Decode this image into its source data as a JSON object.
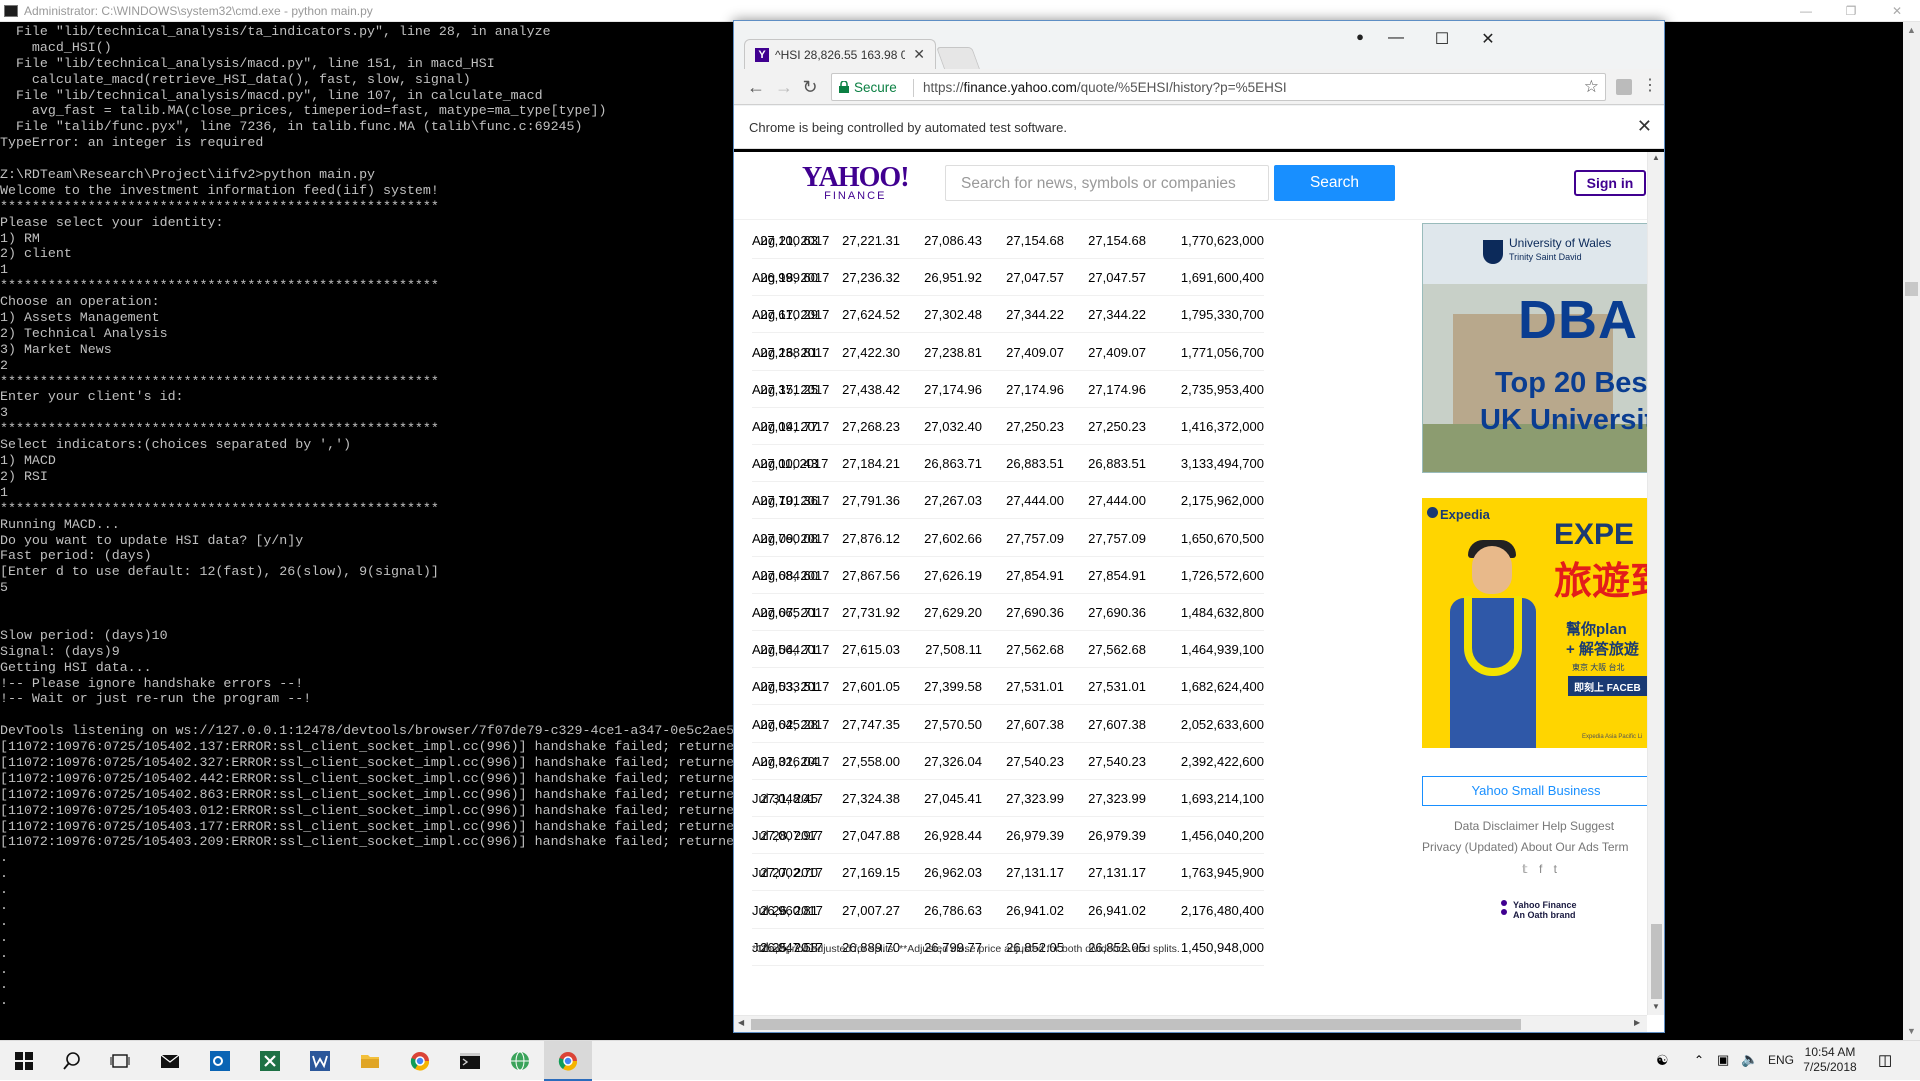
{
  "cmd": {
    "title": "Administrator: C:\\WINDOWS\\system32\\cmd.exe - python  main.py",
    "lines": [
      "  File \"lib/technical_analysis/ta_indicators.py\", line 28, in analyze",
      "    macd_HSI()",
      "  File \"lib/technical_analysis/macd.py\", line 151, in macd_HSI",
      "    calculate_macd(retrieve_HSI_data(), fast, slow, signal)",
      "  File \"lib/technical_analysis/macd.py\", line 107, in calculate_macd",
      "    avg_fast = talib.MA(close_prices, timeperiod=fast, matype=ma_type[type])",
      "  File \"talib/func.pyx\", line 7236, in talib.func.MA (talib\\func.c:69245)",
      "TypeError: an integer is required",
      "",
      "Z:\\RDTeam\\Research\\Project\\iifv2>python main.py",
      "Welcome to the investment information feed(iif) system!",
      "*******************************************************",
      "Please select your identity:",
      "1) RM",
      "2) client",
      "1",
      "*******************************************************",
      "Choose an operation:",
      "1) Assets Management",
      "2) Technical Analysis",
      "3) Market News",
      "2",
      "*******************************************************",
      "Enter your client's id:",
      "3",
      "*******************************************************",
      "Select indicators:(choices separated by ',')",
      "1) MACD",
      "2) RSI",
      "1",
      "*******************************************************",
      "Running MACD...",
      "Do you want to update HSI data? [y/n]y",
      "Fast period: (days)",
      "[Enter d to use default: 12(fast), 26(slow), 9(signal)]",
      "5",
      "",
      "",
      "Slow period: (days)10",
      "Signal: (days)9",
      "Getting HSI data...",
      "!-- Please ignore handshake errors --!",
      "!-- Wait or just re-run the program --!",
      "",
      "DevTools listening on ws://127.0.0.1:12478/devtools/browser/7f07de79-c329-4ce1-a347-0e5c2ae5",
      "[11072:10976:0725/105402.137:ERROR:ssl_client_socket_impl.cc(996)] handshake failed; returne",
      "[11072:10976:0725/105402.327:ERROR:ssl_client_socket_impl.cc(996)] handshake failed; returne",
      "[11072:10976:0725/105402.442:ERROR:ssl_client_socket_impl.cc(996)] handshake failed; returne",
      "[11072:10976:0725/105402.863:ERROR:ssl_client_socket_impl.cc(996)] handshake failed; returne",
      "[11072:10976:0725/105403.012:ERROR:ssl_client_socket_impl.cc(996)] handshake failed; returne",
      "[11072:10976:0725/105403.177:ERROR:ssl_client_socket_impl.cc(996)] handshake failed; returne",
      "[11072:10976:0725/105403.209:ERROR:ssl_client_socket_impl.cc(996)] handshake failed; returne",
      ".",
      ".",
      ".",
      ".",
      ".",
      ".",
      ".",
      ".",
      ".",
      "."
    ]
  },
  "chrome": {
    "tab_title": "^HSI 28,826.55 163.98 0.",
    "secure_label": "Secure",
    "url_prefix": "https://",
    "url_host": "finance.yahoo.com",
    "url_path": "/quote/%5EHSI/history?p=%5EHSI",
    "infobar_message": "Chrome is being controlled by automated test software."
  },
  "yahoo": {
    "logo_main": "YAHOO!",
    "logo_sub": "FINANCE",
    "search_placeholder": "Search for news, symbols or companies",
    "search_button": "Search",
    "sign_in": "Sign in"
  },
  "history_rows": [
    [
      "Aug 21, 2017",
      "27,100.63",
      "27,221.31",
      "27,086.43",
      "27,154.68",
      "27,154.68",
      "1,770,623,000"
    ],
    [
      "Aug 18, 2017",
      "26,999.60",
      "27,236.32",
      "26,951.92",
      "27,047.57",
      "27,047.57",
      "1,691,600,400"
    ],
    [
      "Aug 17, 2017",
      "27,610.29",
      "27,624.52",
      "27,302.48",
      "27,344.22",
      "27,344.22",
      "1,795,330,700"
    ],
    [
      "Aug 16, 2017",
      "27,238.81",
      "27,422.30",
      "27,238.81",
      "27,409.07",
      "27,409.07",
      "1,771,056,700"
    ],
    [
      "Aug 15, 2017",
      "27,371.25",
      "27,438.42",
      "27,174.96",
      "27,174.96",
      "27,174.96",
      "2,735,953,400"
    ],
    [
      "Aug 14, 2017",
      "27,091.77",
      "27,268.23",
      "27,032.40",
      "27,250.23",
      "27,250.23",
      "1,416,372,000"
    ],
    [
      "Aug 11, 2017",
      "27,000.43",
      "27,184.21",
      "26,863.71",
      "26,883.51",
      "26,883.51",
      "3,133,494,700"
    ],
    [
      "Aug 10, 2017",
      "27,791.36",
      "27,791.36",
      "27,267.03",
      "27,444.00",
      "27,444.00",
      "2,175,962,000"
    ],
    [
      "Aug 09, 2017",
      "27,760.08",
      "27,876.12",
      "27,602.66",
      "27,757.09",
      "27,757.09",
      "1,650,670,500"
    ],
    [
      "Aug 08, 2017",
      "27,684.60",
      "27,867.56",
      "27,626.19",
      "27,854.91",
      "27,854.91",
      "1,726,572,600"
    ],
    [
      "Aug 07, 2017",
      "27,665.71",
      "27,731.92",
      "27,629.20",
      "27,690.36",
      "27,690.36",
      "1,484,632,800"
    ],
    [
      "Aug 04, 2017",
      "27,564.71",
      "27,615.03",
      "27,508.11",
      "27,562.68",
      "27,562.68",
      "1,464,939,100"
    ],
    [
      "Aug 03, 2017",
      "27,533.51",
      "27,601.05",
      "27,399.58",
      "27,531.01",
      "27,531.01",
      "1,682,624,400"
    ],
    [
      "Aug 02, 2017",
      "27,645.28",
      "27,747.35",
      "27,570.50",
      "27,607.38",
      "27,607.38",
      "2,052,633,600"
    ],
    [
      "Aug 01, 2017",
      "27,326.04",
      "27,558.00",
      "27,326.04",
      "27,540.23",
      "27,540.23",
      "2,392,422,600"
    ],
    [
      "Jul 31, 2017",
      "27,048.45",
      "27,324.38",
      "27,045.41",
      "27,323.99",
      "27,323.99",
      "1,693,214,100"
    ],
    [
      "Jul 28, 2017",
      "27,007.97",
      "27,047.88",
      "26,928.44",
      "26,979.39",
      "26,979.39",
      "1,456,040,200"
    ],
    [
      "Jul 27, 2017",
      "27,002.70",
      "27,169.15",
      "26,962.03",
      "27,131.17",
      "27,131.17",
      "1,763,945,900"
    ],
    [
      "Jul 26, 2017",
      "26,960.81",
      "27,007.27",
      "26,786.63",
      "26,941.02",
      "26,941.02",
      "2,176,480,400"
    ],
    [
      "Jul 25, 2017",
      "26,847.58",
      "26,889.70",
      "26,799.77",
      "26,852.05",
      "26,852.05",
      "1,450,948,000"
    ]
  ],
  "footnote": "*Close price adjusted for splits.        **Adjusted close price adjusted for both dividends and splits.",
  "ads": {
    "uni_name": "University of Wales",
    "uni_sub": "Trinity Saint David",
    "dba": "DBA",
    "top20": "Top 20 Best",
    "uk_uni": "UK Universit",
    "expedia_brand": "Expedia",
    "expedia_big": "EXPE",
    "expedia_chinese": "旅遊到",
    "expedia_cta1": "幫你plan",
    "expedia_cta2": "+ 解答旅遊",
    "expedia_cities": "東京  大阪  台北",
    "expedia_fb": "即刻上 FACEB",
    "expedia_small": "Expedia Asia Pacific Li"
  },
  "sidebar": {
    "small_business": "Yahoo Small Business",
    "links_row1": "Data Disclaimer   Help   Suggest",
    "links_row2": "Privacy (Updated)  About Our Ads  Term",
    "oath_line1": "Yahoo Finance",
    "oath_line2": "An Oath brand"
  },
  "taskbar": {
    "lang": "ENG",
    "time": "10:54 AM",
    "date": "7/25/2018"
  }
}
